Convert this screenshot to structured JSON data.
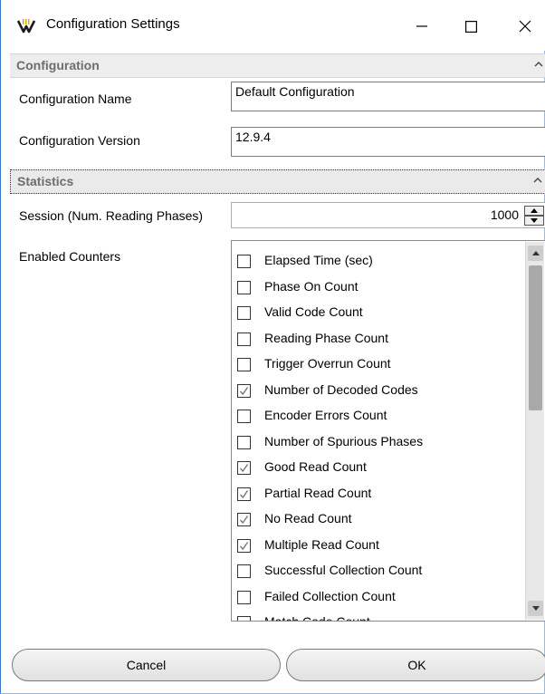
{
  "window": {
    "title": "Configuration Settings",
    "icon": "barcode-reader-icon",
    "controls": [
      "minimize-icon",
      "maximize-icon",
      "close-icon"
    ]
  },
  "configuration": {
    "header": "Configuration",
    "name_label": "Configuration Name",
    "name_value": "Default Configuration",
    "version_label": "Configuration Version",
    "version_value": "12.9.4"
  },
  "statistics": {
    "header": "Statistics",
    "session_label": "Session (Num. Reading Phases)",
    "session_value": "1000",
    "counters_label": "Enabled Counters",
    "counters": [
      {
        "label": "Elapsed Time (sec)",
        "checked": false
      },
      {
        "label": "Phase On Count",
        "checked": false
      },
      {
        "label": "Valid Code Count",
        "checked": false
      },
      {
        "label": "Reading Phase Count",
        "checked": false
      },
      {
        "label": "Trigger Overrun Count",
        "checked": false
      },
      {
        "label": "Number of Decoded Codes",
        "checked": true
      },
      {
        "label": "Encoder Errors Count",
        "checked": false
      },
      {
        "label": "Number of Spurious Phases",
        "checked": false
      },
      {
        "label": "Good Read Count",
        "checked": true
      },
      {
        "label": "Partial Read Count",
        "checked": true
      },
      {
        "label": "No Read Count",
        "checked": true
      },
      {
        "label": "Multiple Read Count",
        "checked": true
      },
      {
        "label": "Successful Collection Count",
        "checked": false
      },
      {
        "label": "Failed Collection Count",
        "checked": false
      },
      {
        "label": "Match Code Count",
        "checked": false
      }
    ]
  },
  "buttons": {
    "cancel": "Cancel",
    "ok": "OK"
  },
  "colors": {
    "window_border": "#3c78c8",
    "section_header_bg": "#ededed",
    "section_header_text": "#6d6d6d",
    "check_mark": "#6b7a8a"
  }
}
